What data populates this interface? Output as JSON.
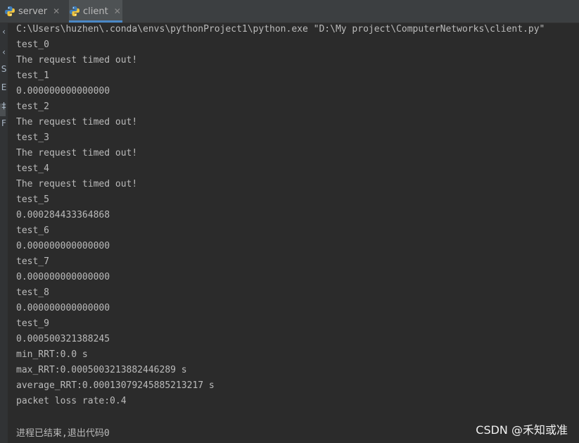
{
  "tabs": [
    {
      "label": "server",
      "icon": "python-icon",
      "active": false
    },
    {
      "label": "client",
      "icon": "python-icon",
      "active": true
    }
  ],
  "left_strip": [
    "‹",
    "‹",
    "S",
    "E",
    "‡",
    "F"
  ],
  "console": {
    "command": "C:\\Users\\huzhen\\.conda\\envs\\pythonProject1\\python.exe \"D:\\My project\\ComputerNetworks\\client.py\"",
    "lines": [
      "test_0",
      "The request timed out!",
      "test_1",
      "0.000000000000000",
      "test_2",
      "The request timed out!",
      "test_3",
      "The request timed out!",
      "test_4",
      "The request timed out!",
      "test_5",
      "0.000284433364868",
      "test_6",
      "0.000000000000000",
      "test_7",
      "0.000000000000000",
      "test_8",
      "0.000000000000000",
      "test_9",
      "0.000500321388245",
      "min_RRT:0.0 s",
      "max_RRT:0.0005003213882446289 s",
      "average_RRT:0.00013079245885213217 s",
      "packet loss rate:0.4"
    ],
    "exit_message": "进程已结束,退出代码0"
  },
  "watermark": "CSDN @禾知或准",
  "colors": {
    "background": "#2b2b2b",
    "tabbar": "#3c3f41",
    "text": "#bbbbbb",
    "active_tab_underline": "#4a88c7"
  }
}
